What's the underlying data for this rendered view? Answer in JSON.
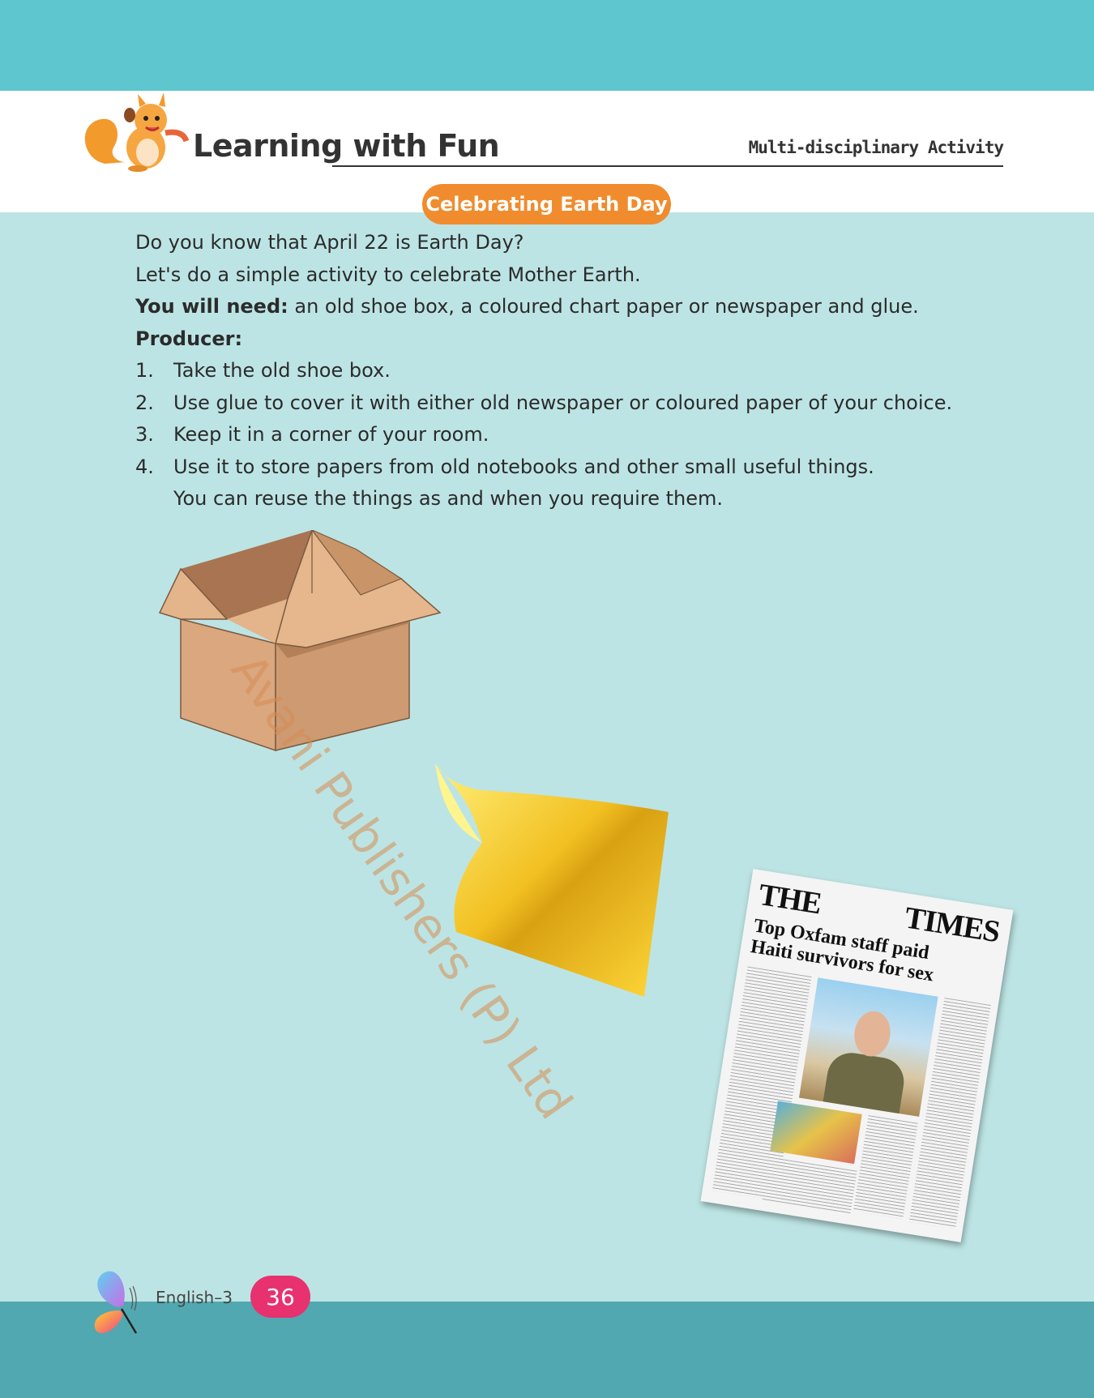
{
  "header": {
    "title": "Learning with Fun",
    "right_label": "Multi-disciplinary Activity"
  },
  "section_title": "Celebrating Earth Day",
  "intro": [
    "Do you know that April 22 is Earth Day?",
    "Let's do a simple activity to celebrate Mother Earth."
  ],
  "needs": {
    "label": "You will need:",
    "text": " an old shoe box, a coloured chart paper or newspaper and glue."
  },
  "procedure_label": "Producer:",
  "steps": [
    {
      "num": "1.",
      "text": "Take the old shoe box."
    },
    {
      "num": "2.",
      "text": "Use glue to cover it with either old newspaper or coloured paper of your choice."
    },
    {
      "num": "3.",
      "text": "Keep it in a corner of your room."
    },
    {
      "num": "4.",
      "text": "Use it to store papers from old notebooks and other small useful things."
    },
    {
      "num": "",
      "text": "You can reuse the things as and when you require them."
    }
  ],
  "newspaper": {
    "masthead_left": "THE",
    "masthead_right": "TIMES",
    "headline1": "Top Oxfam staff paid",
    "headline2": "Haiti survivors for sex"
  },
  "watermark": "Avani Publishers (P) Ltd",
  "footer": {
    "label": "English–3",
    "page_number": "36"
  },
  "colors": {
    "top_band": "#5dc6cf",
    "background": "#bde4e4",
    "pill": "#f08c2e",
    "page_badge": "#e8316f",
    "bottom_band": "#52a8b0"
  }
}
